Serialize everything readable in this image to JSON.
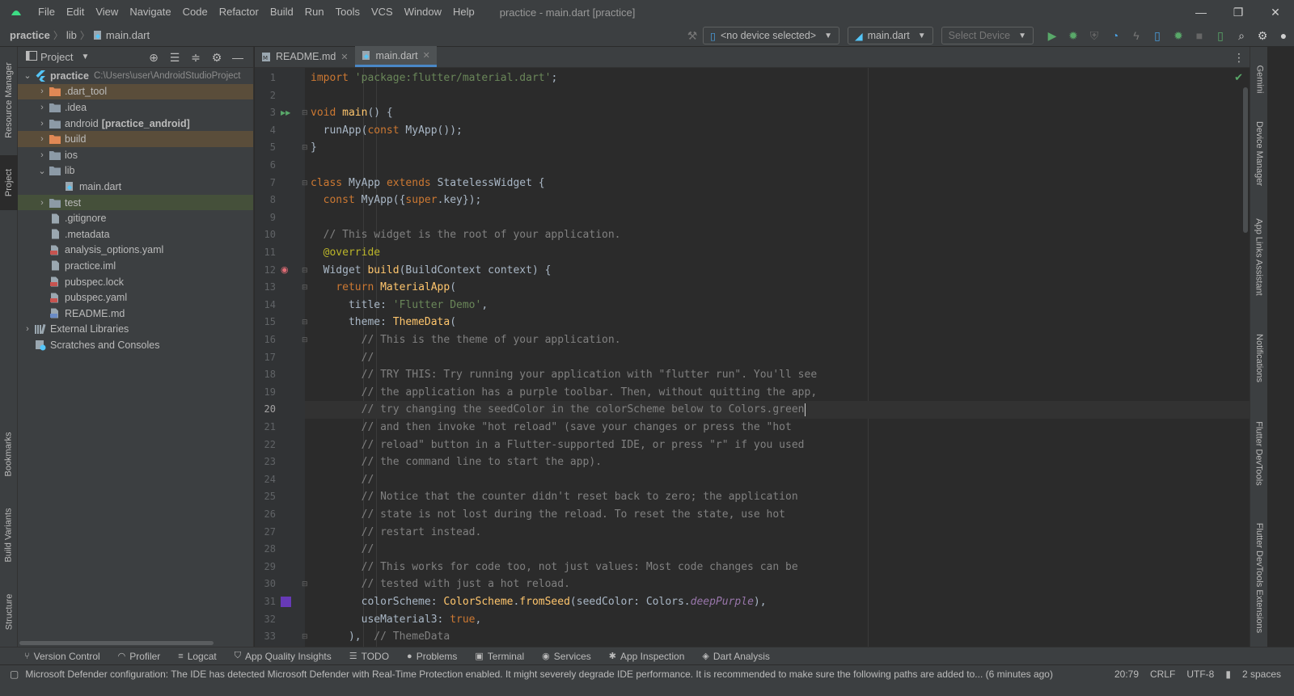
{
  "window": {
    "menu": [
      "File",
      "Edit",
      "View",
      "Navigate",
      "Code",
      "Refactor",
      "Build",
      "Run",
      "Tools",
      "VCS",
      "Window",
      "Help"
    ],
    "title": "practice - main.dart [practice]",
    "controls": [
      "—",
      "❐",
      "✕"
    ]
  },
  "nav": {
    "project": "practice",
    "folder": "lib",
    "file": "main.dart",
    "device_combo": "<no device selected>",
    "run_config": "main.dart",
    "select_device": "Select Device"
  },
  "project_panel": {
    "title": "Project",
    "tree": [
      {
        "name": "practice",
        "path": "C:\\Users\\user\\AndroidStudioProject",
        "indent": 0,
        "arrow": "⌄",
        "icon": "flutter-icon",
        "style": "root"
      },
      {
        "name": ".dart_tool",
        "indent": 1,
        "arrow": "›",
        "icon": "folder-icon",
        "style": "excluded"
      },
      {
        "name": ".idea",
        "indent": 1,
        "arrow": "›",
        "icon": "folder-icon",
        "style": ""
      },
      {
        "name": "android",
        "suffix": "[practice_android]",
        "indent": 1,
        "arrow": "›",
        "icon": "folder-icon",
        "style": ""
      },
      {
        "name": "build",
        "indent": 1,
        "arrow": "›",
        "icon": "folder-icon",
        "style": "excluded"
      },
      {
        "name": "ios",
        "indent": 1,
        "arrow": "›",
        "icon": "folder-icon",
        "style": ""
      },
      {
        "name": "lib",
        "indent": 1,
        "arrow": "⌄",
        "icon": "folder-icon",
        "style": ""
      },
      {
        "name": "main.dart",
        "indent": 2,
        "arrow": "",
        "icon": "dart-file-icon",
        "style": ""
      },
      {
        "name": "test",
        "indent": 1,
        "arrow": "›",
        "icon": "folder-icon",
        "style": "test"
      },
      {
        "name": ".gitignore",
        "indent": 1,
        "arrow": "",
        "icon": "file-icon",
        "style": ""
      },
      {
        "name": ".metadata",
        "indent": 1,
        "arrow": "",
        "icon": "file-icon",
        "style": ""
      },
      {
        "name": "analysis_options.yaml",
        "indent": 1,
        "arrow": "",
        "icon": "yaml-file-icon",
        "style": ""
      },
      {
        "name": "practice.iml",
        "indent": 1,
        "arrow": "",
        "icon": "file-icon",
        "style": ""
      },
      {
        "name": "pubspec.lock",
        "indent": 1,
        "arrow": "",
        "icon": "yaml-file-icon",
        "style": ""
      },
      {
        "name": "pubspec.yaml",
        "indent": 1,
        "arrow": "",
        "icon": "yaml-file-icon",
        "style": ""
      },
      {
        "name": "README.md",
        "indent": 1,
        "arrow": "",
        "icon": "md-file-icon",
        "style": ""
      },
      {
        "name": "External Libraries",
        "indent": 0,
        "arrow": "›",
        "icon": "library-icon",
        "style": ""
      },
      {
        "name": "Scratches and Consoles",
        "indent": 0,
        "arrow": "",
        "icon": "scratch-icon",
        "style": ""
      }
    ]
  },
  "editor": {
    "tabs": [
      {
        "label": "README.md",
        "active": false
      },
      {
        "label": "main.dart",
        "active": true
      }
    ],
    "current_line": 20,
    "lines": [
      {
        "n": "1",
        "html": "<span class=\"kw\">import </span><span class=\"str\">'package:flutter/material.dart'</span>;"
      },
      {
        "n": "2",
        "html": ""
      },
      {
        "n": "3",
        "html": "<span class=\"kw\">void </span><span class=\"fn\">main</span>() {"
      },
      {
        "n": "4",
        "html": "  runApp(<span class=\"kw\">const </span>MyApp());"
      },
      {
        "n": "5",
        "html": "}"
      },
      {
        "n": "6",
        "html": ""
      },
      {
        "n": "7",
        "html": "<span class=\"kw\">class </span>MyApp <span class=\"kw\">extends </span>StatelessWidget {"
      },
      {
        "n": "8",
        "html": "  <span class=\"kw\">const </span>MyApp({<span class=\"kw\">super</span>.key});"
      },
      {
        "n": "9",
        "html": ""
      },
      {
        "n": "10",
        "html": "  <span class=\"cm\">// This widget is the root of your application.</span>"
      },
      {
        "n": "11",
        "html": "  <span class=\"ann\">@override</span>"
      },
      {
        "n": "12",
        "html": "  Widget <span class=\"fn\">build</span>(BuildContext context) {"
      },
      {
        "n": "13",
        "html": "    <span class=\"kw\">return </span><span class=\"fn\">MaterialApp</span>("
      },
      {
        "n": "14",
        "html": "      title: <span class=\"str\">'Flutter Demo'</span>,"
      },
      {
        "n": "15",
        "html": "      theme: <span class=\"fn\">ThemeData</span>("
      },
      {
        "n": "16",
        "html": "        <span class=\"cm\">// This is the theme of your application.</span>"
      },
      {
        "n": "17",
        "html": "        <span class=\"cm\">//</span>"
      },
      {
        "n": "18",
        "html": "        <span class=\"cm\">// TRY THIS: Try running your application with \"flutter run\". You'll see</span>"
      },
      {
        "n": "19",
        "html": "        <span class=\"cm\">// the application has a purple toolbar. Then, without quitting the app,</span>"
      },
      {
        "n": "20",
        "html": "        <span class=\"cm\">// try changing the seedColor in the colorScheme below to Colors.green</span><span class=\"caret-bar\"></span>"
      },
      {
        "n": "21",
        "html": "        <span class=\"cm\">// and then invoke \"hot reload\" (save your changes or press the \"hot</span>"
      },
      {
        "n": "22",
        "html": "        <span class=\"cm\">// reload\" button in a Flutter-supported IDE, or press \"r\" if you used</span>"
      },
      {
        "n": "23",
        "html": "        <span class=\"cm\">// the command line to start the app).</span>"
      },
      {
        "n": "24",
        "html": "        <span class=\"cm\">//</span>"
      },
      {
        "n": "25",
        "html": "        <span class=\"cm\">// Notice that the counter didn't reset back to zero; the application</span>"
      },
      {
        "n": "26",
        "html": "        <span class=\"cm\">// state is not lost during the reload. To reset the state, use hot</span>"
      },
      {
        "n": "27",
        "html": "        <span class=\"cm\">// restart instead.</span>"
      },
      {
        "n": "28",
        "html": "        <span class=\"cm\">//</span>"
      },
      {
        "n": "29",
        "html": "        <span class=\"cm\">// This works for code too, not just values: Most code changes can be</span>"
      },
      {
        "n": "30",
        "html": "        <span class=\"cm\">// tested with just a hot reload.</span>"
      },
      {
        "n": "31",
        "html": "        colorScheme: <span class=\"fn\">ColorScheme</span>.<span class=\"fn\">fromSeed</span>(seedColor: Colors.<span class=\"param\">deepPurple</span>),"
      },
      {
        "n": "32",
        "html": "        useMaterial3: <span class=\"kw\">true</span>,"
      },
      {
        "n": "33",
        "html": "      ),  <span class=\"cm\">// ThemeData</span>"
      }
    ]
  },
  "left_tabs": [
    "Resource Manager",
    "Project",
    "Bookmarks",
    "Build Variants",
    "Structure"
  ],
  "right_tabs": [
    "Gemini",
    "Device Manager",
    "App Links Assistant",
    "Notifications",
    "Flutter DevTools",
    "Flutter DevTools Extensions"
  ],
  "bottom_tools": [
    {
      "label": "Version Control",
      "icon": "version-control-icon",
      "glyph": "⑂"
    },
    {
      "label": "Profiler",
      "icon": "profiler-icon",
      "glyph": "◠"
    },
    {
      "label": "Logcat",
      "icon": "logcat-icon",
      "glyph": "≡"
    },
    {
      "label": "App Quality Insights",
      "icon": "app-quality-icon",
      "glyph": "⛉"
    },
    {
      "label": "TODO",
      "icon": "todo-icon",
      "glyph": "☰"
    },
    {
      "label": "Problems",
      "icon": "problems-icon",
      "glyph": "●"
    },
    {
      "label": "Terminal",
      "icon": "terminal-icon",
      "glyph": "▣"
    },
    {
      "label": "Services",
      "icon": "services-icon",
      "glyph": "◉"
    },
    {
      "label": "App Inspection",
      "icon": "app-inspection-icon",
      "glyph": "✱"
    },
    {
      "label": "Dart Analysis",
      "icon": "dart-analysis-icon",
      "glyph": "◈"
    }
  ],
  "status": {
    "message": "Microsoft Defender configuration: The IDE has detected Microsoft Defender with Real-Time Protection enabled. It might severely degrade IDE performance. It is recommended to make sure the following paths are added to... (6 minutes ago)",
    "position": "20:79",
    "line_sep": "CRLF",
    "encoding": "UTF-8",
    "indent": "2 spaces"
  },
  "colors": {
    "flutter_blue": "#54c5f8",
    "folder": "#8c9aa6",
    "excluded_folder": "#e08855",
    "run_green": "#59a869",
    "swatch_deep_purple": "#673ab7"
  }
}
